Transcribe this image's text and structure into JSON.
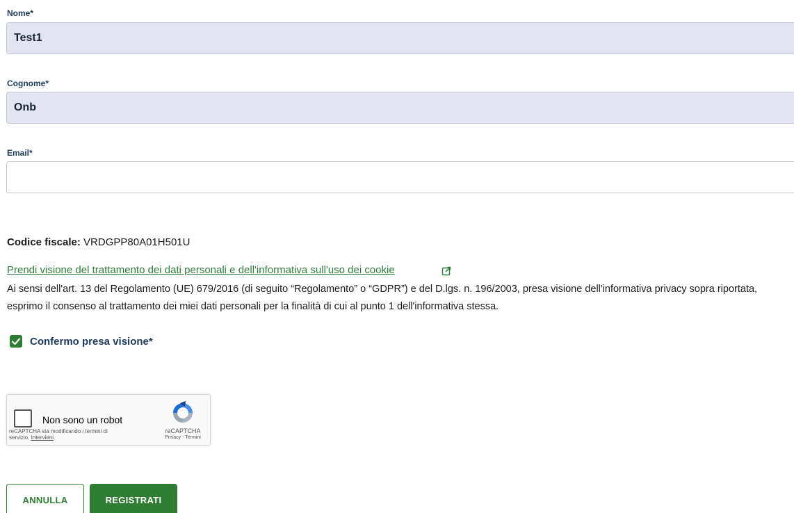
{
  "form": {
    "nome": {
      "label": "Nome*",
      "value": "Test1"
    },
    "cognome": {
      "label": "Cognome*",
      "value": "Onb"
    },
    "email": {
      "label": "Email*",
      "value": ""
    }
  },
  "codice_fiscale": {
    "label": "Codice fiscale:",
    "value": "VRDGPP80A01H501U"
  },
  "privacy": {
    "link_text": "Prendi visione del trattamento dei dati personali e dell'informativa sull'uso dei cookie",
    "link_icon": "external-link-icon",
    "text": "Ai sensi dell'art. 13 del Regolamento (UE) 679/2016 (di seguito “Regolamento” o “GDPR”) e del D.lgs. n. 196/2003, presa visione dell'informativa privacy sopra riportata, esprimo il consenso al trattamento dei miei dati personali per la finalità di cui al punto 1 dell'informativa stessa."
  },
  "consent": {
    "label": "Confermo presa visione*",
    "checked": true
  },
  "recaptcha": {
    "label": "Non sono un robot",
    "notice": "reCAPTCHA sta modificando i termini di servizio.",
    "notice_link": "Intervieni",
    "brand": "reCAPTCHA",
    "privacy_link": "Privacy",
    "separator": " - ",
    "terms_link": "Termini"
  },
  "buttons": {
    "cancel": "ANNULLA",
    "submit": "REGISTRATI"
  },
  "colors": {
    "accent": "#2e7d32",
    "label": "#1b3a5c",
    "filled_input_bg": "#e2e5f1"
  }
}
